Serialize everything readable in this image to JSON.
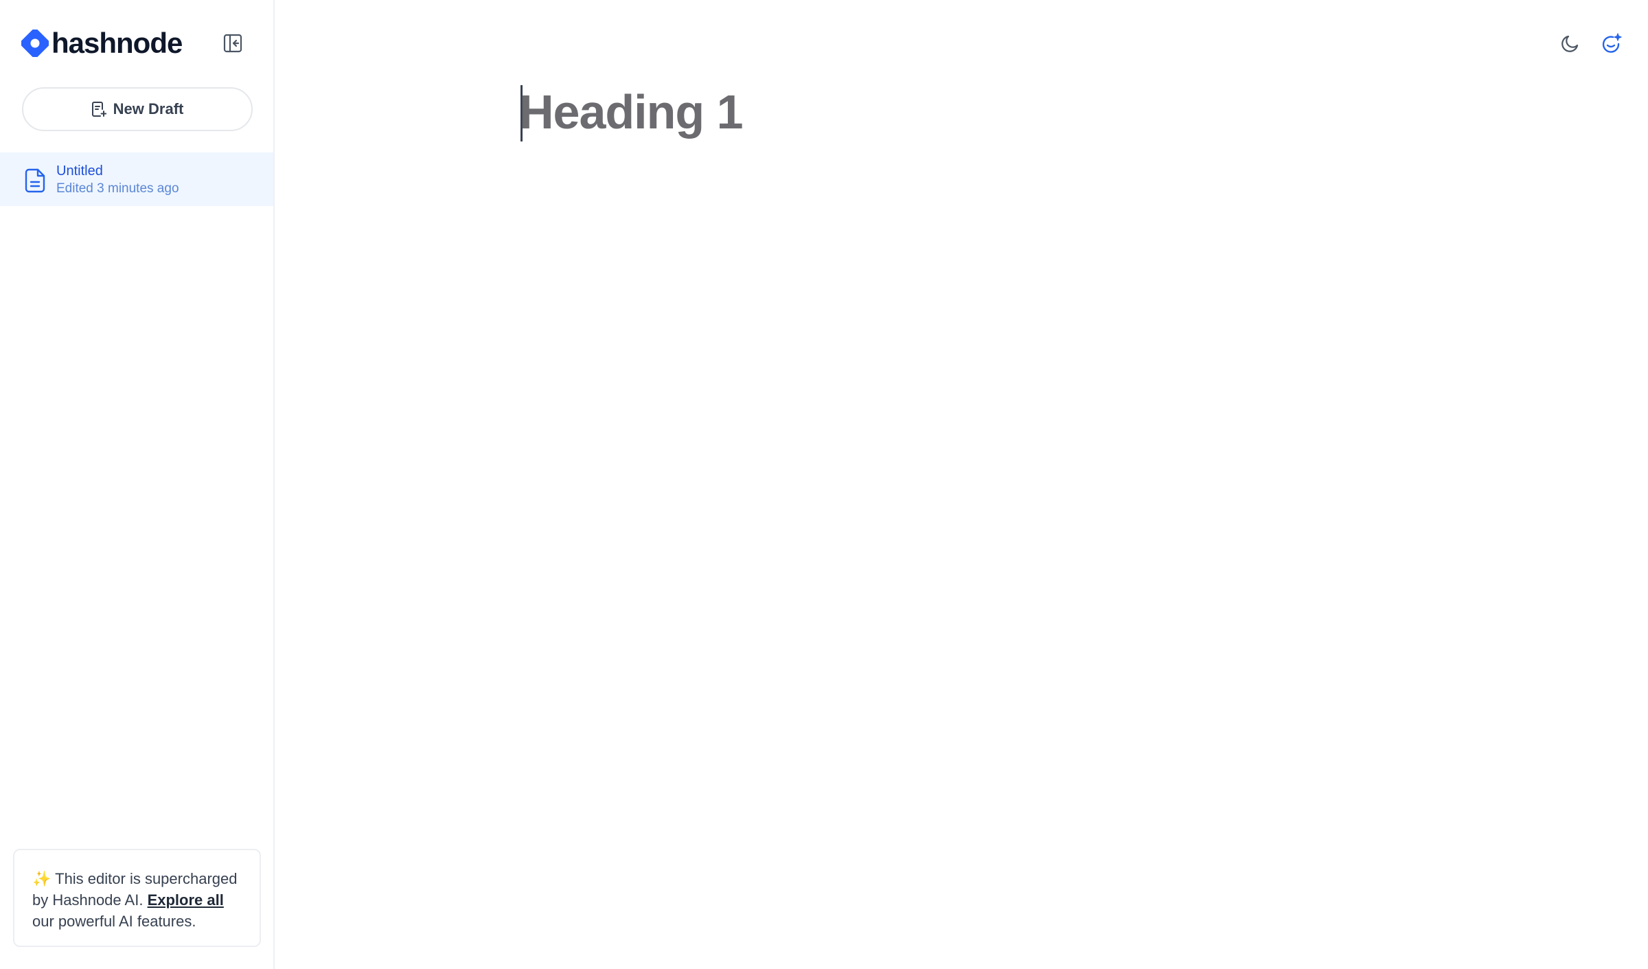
{
  "brand": {
    "name": "hashnode",
    "color": "#2962ff"
  },
  "sidebar": {
    "collapse_icon": "sidebar-collapse-icon",
    "new_draft_label": "New Draft",
    "new_draft_icon": "document-add-icon",
    "drafts": [
      {
        "title": "Untitled",
        "meta": "Edited 3 minutes ago",
        "icon": "document-icon"
      }
    ],
    "ai_card": {
      "sparkle": "✨",
      "text_before": "This editor is supercharged by Hashnode AI.",
      "link": "Explore all",
      "text_after": "our powerful AI features."
    }
  },
  "toolbar": {
    "theme_icon": "moon-icon",
    "ai_icon": "ai-assistant-icon"
  },
  "editor": {
    "heading_placeholder": "Heading 1"
  },
  "colors": {
    "accent": "#2962ff",
    "selected_bg": "#eff6ff",
    "selected_text": "#1d4ed8",
    "placeholder": "#6b6b70"
  }
}
